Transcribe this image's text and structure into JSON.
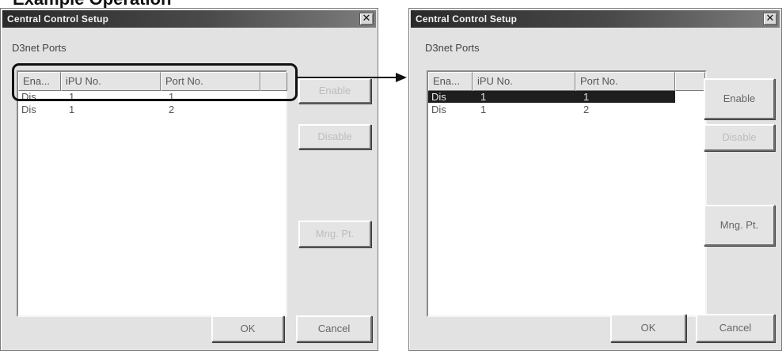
{
  "page_heading": "Example Operation",
  "left_dialog": {
    "title": "Central Control Setup",
    "close_glyph": "✕",
    "group_label": "D3net Ports",
    "columns": [
      "Ena...",
      "iPU No.",
      "Port No."
    ],
    "rows": [
      {
        "ena": "Dis",
        "ipu": "1",
        "port": "1",
        "selected": false
      },
      {
        "ena": "Dis",
        "ipu": "1",
        "port": "2",
        "selected": false
      }
    ],
    "buttons": {
      "enable": "Enable",
      "disable": "Disable",
      "mng_pt": "Mng. Pt.",
      "ok": "OK",
      "cancel": "Cancel"
    }
  },
  "right_dialog": {
    "title": "Central Control Setup",
    "close_glyph": "✕",
    "group_label": "D3net Ports",
    "columns": [
      "Ena...",
      "iPU No.",
      "Port No."
    ],
    "rows": [
      {
        "ena": "Dis",
        "ipu": "1",
        "port": "1",
        "selected": true
      },
      {
        "ena": "Dis",
        "ipu": "1",
        "port": "2",
        "selected": false
      }
    ],
    "buttons": {
      "enable": "Enable",
      "disable": "Disable",
      "mng_pt": "Mng. Pt.",
      "ok": "OK",
      "cancel": "Cancel"
    }
  },
  "colors": {
    "selection": "#1e1e1e",
    "dialog_bg": "#e2e2e2",
    "callout": "#111111"
  }
}
